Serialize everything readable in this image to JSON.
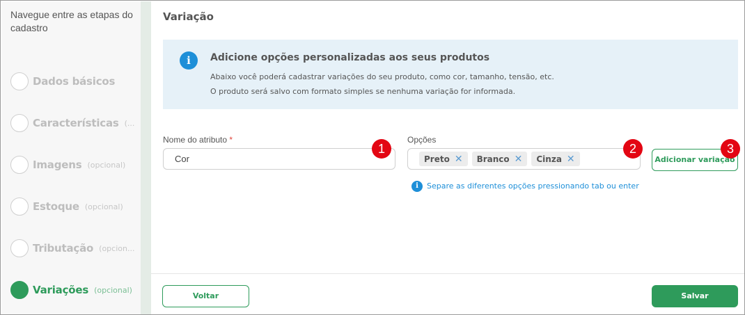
{
  "sidebar": {
    "title": "Navegue entre as etapas do cadastro",
    "steps": [
      {
        "label": "Dados básicos",
        "optional": ""
      },
      {
        "label": "Características",
        "optional": "(..."
      },
      {
        "label": "Imagens",
        "optional": "(opcional)"
      },
      {
        "label": "Estoque",
        "optional": "(opcional)"
      },
      {
        "label": "Tributação",
        "optional": "(opcion..."
      },
      {
        "label": "Variações",
        "optional": "(opcional)"
      }
    ]
  },
  "main": {
    "section_title": "Variação",
    "info": {
      "icon": "i",
      "heading": "Adicione opções personalizadas aos seus produtos",
      "line1": "Abaixo você poderá cadastrar variações do seu produto, como cor, tamanho, tensão, etc.",
      "line2": "O produto será salvo com formato simples se nenhuma variação for informada."
    },
    "attribute": {
      "label": "Nome do atributo",
      "required_mark": "*",
      "value": "Cor"
    },
    "options": {
      "label": "Opções",
      "tags": [
        "Preto",
        "Branco",
        "Cinza"
      ],
      "remove_glyph": "✕",
      "hint": "Separe as diferentes opções pressionando tab ou enter"
    },
    "add_button": "Adicionar variação",
    "back_button": "Voltar",
    "save_button": "Salvar"
  },
  "callouts": [
    "1",
    "2",
    "3"
  ],
  "colors": {
    "accent_green": "#2e9b5b",
    "info_blue": "#1e8fd8",
    "info_bg": "#e6f1f8",
    "callout_red": "#e30613"
  }
}
